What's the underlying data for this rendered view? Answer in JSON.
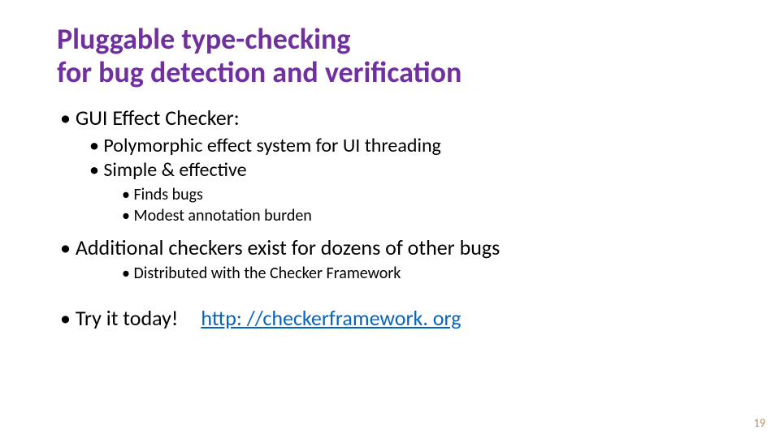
{
  "title_line1": "Pluggable type-checking",
  "title_line2": "for bug detection and verification",
  "b1": "GUI Effect Checker:",
  "b1_1": "Polymorphic effect system for UI threading",
  "b1_2": "Simple & effective",
  "b1_2_1": "Finds bugs",
  "b1_2_2": "Modest annotation burden",
  "b2": "Additional checkers exist for dozens of other bugs",
  "b2_1": "Distributed with the Checker Framework",
  "b3": "Try it today!",
  "link": "http: //checkerframework. org",
  "page": "19"
}
